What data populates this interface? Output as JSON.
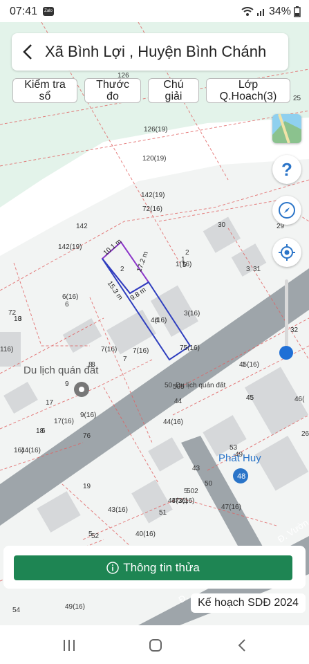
{
  "status": {
    "time": "07:41",
    "app_icon": "Zalo",
    "battery": "34%"
  },
  "header": {
    "title": "Xã Bình Lợi , Huyện Bình Chánh"
  },
  "chips": [
    {
      "line1": "Kiểm tra",
      "line2": "sổ"
    },
    {
      "line1": "Thước",
      "line2": "đo"
    },
    {
      "line1": "Chú",
      "line2": "giải"
    },
    {
      "line1": "Lớp",
      "line2": "Q.Hoach(3)"
    }
  ],
  "map": {
    "road_label_1": "Đ. Vườn",
    "road_label_2": "Đ.",
    "poi_1": "Du lịch quán đất",
    "poi_2": "Phát Huy",
    "poi_3": "48",
    "measures": [
      "10.1 m",
      "17.2 m",
      "15.3 m",
      "9.8 m"
    ],
    "zoom": "32",
    "parcels": [
      "126",
      "126(19)",
      "120(19)",
      "142(19)",
      "72(16)",
      "142",
      "142(19)",
      "30",
      "2",
      "1(16)",
      "3",
      "31",
      "2",
      "1",
      "6(16)",
      "6",
      "72",
      "10",
      "4(16)",
      "4",
      "3(16)",
      "3",
      "116)",
      "7(16)",
      "7(16)",
      "7",
      "8",
      "8",
      "75(16)",
      "Du lịch quán đất",
      "9",
      "17",
      "50",
      "505",
      "44",
      "44(16)",
      "45(16)",
      "45",
      "46(",
      "17(16)",
      "9(16)",
      "18",
      "6",
      "76",
      "16)",
      "44(16)",
      "19",
      "43(16)",
      "43",
      "502",
      "5",
      "50",
      "49",
      "47",
      "51",
      "52",
      "53",
      "47(16)",
      "49(16)",
      "54",
      "40(16)",
      "43(16)",
      "5",
      "3(16)",
      "5",
      "1",
      "45",
      "32",
      "25",
      "29",
      "26",
      "5"
    ]
  },
  "buttons": {
    "info": "Thông tin thửa"
  },
  "plan_badge": "Kế hoạch SDĐ 2024",
  "colors": {
    "accent": "#1e8553",
    "slider": "#1f6fd6",
    "parcel_outline": "#2f3fbf",
    "parcel_highlight": "#8b35c9"
  }
}
